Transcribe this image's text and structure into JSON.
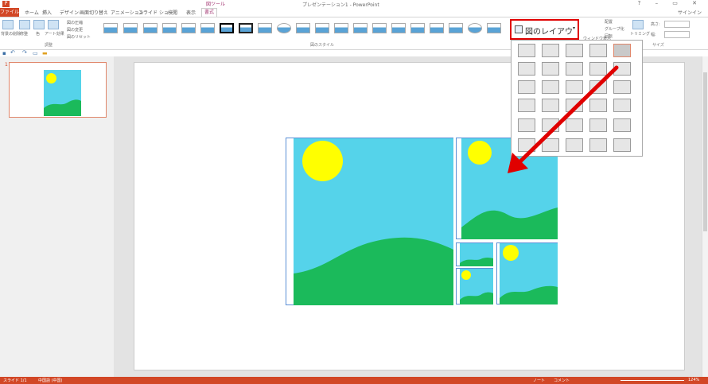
{
  "window": {
    "title": "プレゼンテーション1 - PowerPoint",
    "context_tab_group": "図ツール",
    "signin": "サインイン"
  },
  "tabs": [
    "ファイル",
    "ホーム",
    "挿入",
    "デザイン",
    "画面切り替え",
    "アニメーション",
    "スライド ショー",
    "校閲",
    "表示",
    "書式"
  ],
  "ribbon": {
    "adjust": {
      "btn1": "背景の削除",
      "btn2": "修整",
      "btn3": "色",
      "btn4": "アート効果",
      "compress": "図の圧縮",
      "change": "図の変更",
      "reset": "図のリセット",
      "group": "調整"
    },
    "styles_group": "図のスタイル",
    "layout_button": "図のレイアウト",
    "arrange": {
      "front": "配置",
      "group": "グループ化",
      "rotate": "回転",
      "select_pane": "ウィンドウ表示"
    },
    "size": {
      "crop": "トリミング",
      "height_label": "高さ:",
      "width_label": "幅:",
      "group": "サイズ"
    }
  },
  "slides": {
    "num": "1"
  },
  "status": {
    "slide": "スライド 1/1",
    "lang": "中国語 (中国)",
    "notes": "ノート",
    "comments": "コメント",
    "zoom": "124%"
  },
  "colors": {
    "accent": "#d24726",
    "sky": "#55d3ea",
    "hill": "#1bba5b",
    "sun": "#ffff00",
    "highlight": "#e00000"
  }
}
